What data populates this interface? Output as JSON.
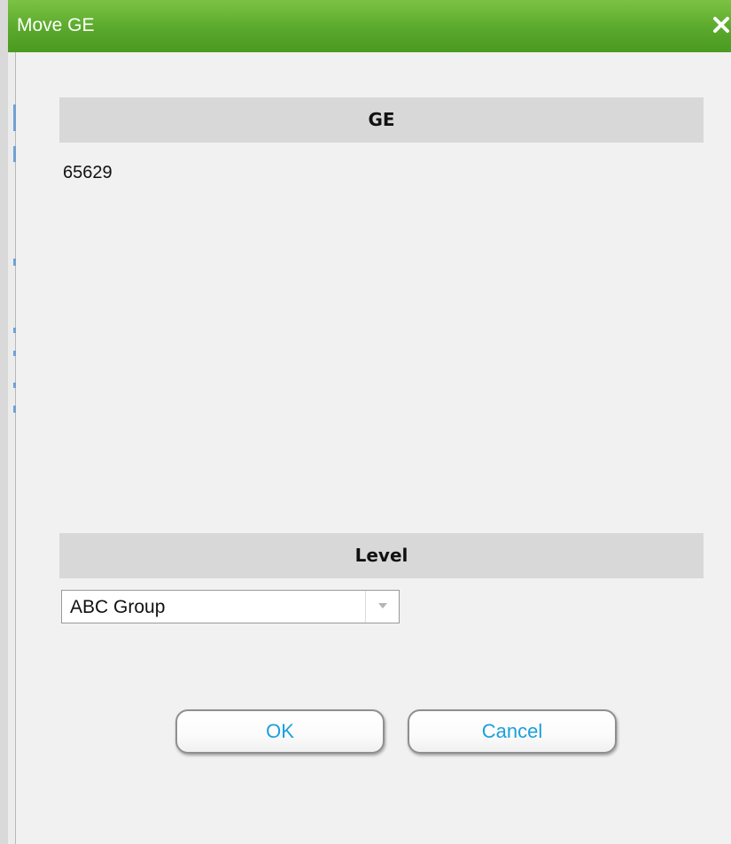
{
  "window": {
    "title": "Move GE",
    "close_icon": "close-icon"
  },
  "ge_section": {
    "header": "GE",
    "value": "65629"
  },
  "level_section": {
    "header": "Level",
    "selected": "ABC Group",
    "dropdown_icon": "chevron-down-icon"
  },
  "buttons": {
    "ok_label": "OK",
    "cancel_label": "Cancel"
  },
  "colors": {
    "titlebar": "#5aa92c",
    "button_text": "#1ba0dc",
    "section_header_bg": "#d8d8d8",
    "dialog_bg": "#f1f1f1"
  }
}
